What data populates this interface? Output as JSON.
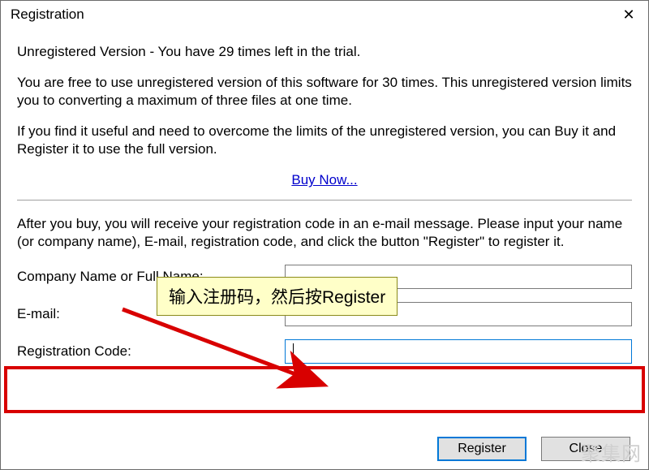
{
  "title": "Registration",
  "close_glyph": "✕",
  "status_line": "Unregistered Version - You have 29 times left in the trial.",
  "para1": "You are free to use unregistered version of this software for 30 times. This unregistered version limits you to converting a maximum of three files at one time.",
  "para2": "If you find it useful and need to overcome the limits of the unregistered version, you can Buy it and Register it to use the full version.",
  "buy_link": "Buy Now...",
  "para3": "After you buy, you will receive your registration code in an e-mail message. Please input your name (or company name), E-mail, registration code, and click the button \"Register\" to register it.",
  "form": {
    "name_label": "Company Name or Full Name:",
    "name_value": "",
    "email_label": "E-mail:",
    "email_value": "",
    "code_label": "Registration Code:",
    "code_value": ""
  },
  "callout_text": "输入注册码，然后按Register",
  "buttons": {
    "register": "Register",
    "close": "Close"
  },
  "watermark": "聚集网",
  "colors": {
    "highlight": "#d80000",
    "link": "#0000cc",
    "accent": "#0078d7",
    "callout_bg": "#ffffc8"
  }
}
